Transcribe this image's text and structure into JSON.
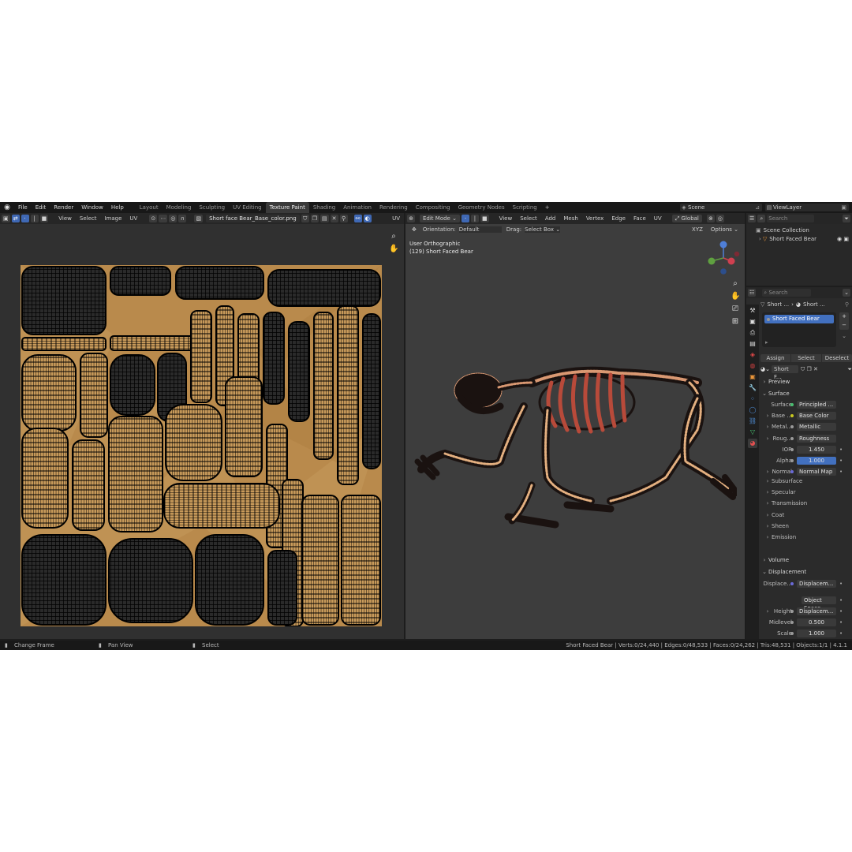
{
  "menu": [
    "File",
    "Edit",
    "Render",
    "Window",
    "Help"
  ],
  "workspaces": [
    "Layout",
    "Modeling",
    "Sculpting",
    "UV Editing",
    "Texture Paint",
    "Shading",
    "Animation",
    "Rendering",
    "Compositing",
    "Geometry Nodes",
    "Scripting"
  ],
  "active_workspace": "Texture Paint",
  "scene": "Scene",
  "view_layer": "ViewLayer",
  "image_editor": {
    "menus": [
      "View",
      "Select",
      "Image",
      "UV"
    ],
    "image_name": "Short face Bear_Base_color.png",
    "uv_label": "UV"
  },
  "viewport": {
    "mode": "Edit Mode",
    "menus": [
      "View",
      "Select",
      "Add",
      "Mesh",
      "Vertex",
      "Edge",
      "Face",
      "UV"
    ],
    "transform": "Global",
    "orientation_label": "Orientation:",
    "orientation_value": "Default",
    "drag_label": "Drag:",
    "drag_value": "Select Box",
    "axes": [
      "X",
      "Y",
      "Z"
    ],
    "options": "Options",
    "view_name": "User Orthographic",
    "object_info": "(129) Short Faced Bear"
  },
  "outliner": {
    "search_placeholder": "Search",
    "collection": "Scene Collection",
    "object": "Short Faced Bear"
  },
  "properties": {
    "search_placeholder": "Search",
    "breadcrumb": [
      "Short ...",
      "Short ..."
    ],
    "material_slot": "Short Faced Bear",
    "buttons": [
      "Assign",
      "Select",
      "Deselect"
    ],
    "material_name": "Short F...",
    "sections": {
      "preview": "Preview",
      "surface": "Surface",
      "volume": "Volume",
      "displacement": "Displacement"
    },
    "surface_rows": [
      {
        "label": "Surface",
        "value": "Principled ...",
        "dot": "green"
      },
      {
        "label": "Base ...",
        "value": "Base Color",
        "dot": "yellow"
      },
      {
        "label": "Metal...",
        "value": "Metallic",
        "dot": "gray"
      },
      {
        "label": "Roug...",
        "value": "Roughness",
        "dot": "gray"
      },
      {
        "label": "IOR",
        "value": "1.450",
        "dot": "gray"
      },
      {
        "label": "Alpha",
        "value": "1.000",
        "dot": "gray"
      },
      {
        "label": "Normal",
        "value": "Normal Map",
        "dot": "blue"
      }
    ],
    "sub_sections": [
      "Subsurface",
      "Specular",
      "Transmission",
      "Coat",
      "Sheen",
      "Emission"
    ],
    "displacement_rows": [
      {
        "label": "Displace...",
        "value": "Displacem...",
        "dot": "blue"
      },
      {
        "label": "",
        "value": "Object Space",
        "dot": ""
      },
      {
        "label": "Height",
        "value": "Displacem...",
        "dot": "gray"
      },
      {
        "label": "Midlevel",
        "value": "0.500",
        "dot": "gray"
      },
      {
        "label": "Scale",
        "value": "1.000",
        "dot": "gray"
      }
    ]
  },
  "status": {
    "left": "Change Frame",
    "middle": "Pan View",
    "select": "Select",
    "stats": "Short Faced Bear | Verts:0/24,440 | Edges:0/48,533 | Faces:0/24,262 | Tris:48,531 | Objects:1/1 | 4.1.1"
  },
  "colors": {
    "accent": "#3f68b4",
    "uv_background": "#b98a4c",
    "uv_wire": "#000000",
    "bear_wire": "#e0a080"
  },
  "icons": [
    "blender-logo",
    "zoom-icon",
    "hand-icon",
    "camera-icon",
    "grid-icon",
    "eye-icon",
    "pin-icon"
  ]
}
